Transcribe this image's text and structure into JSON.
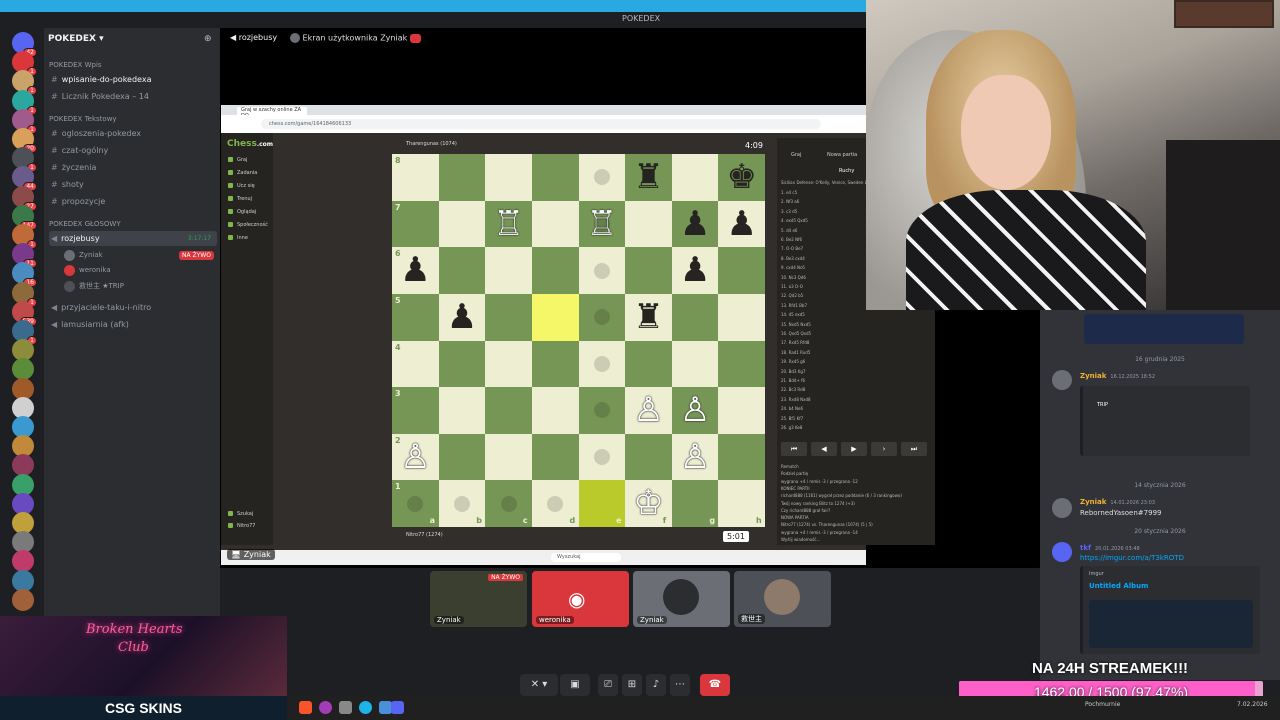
{
  "window_title": "POKEDEX",
  "server": {
    "name": "POKEDEX",
    "categories": {
      "wpis": "POKEDEX Wpis",
      "tekstowy": "POKEDEX Tekstowy",
      "glosowy": "POKEDEX GŁOSOWY"
    },
    "channels": {
      "wpisanie": "wpisanie-do-pokedexa",
      "licznik": "Licznik Pokedexa – 14",
      "ogloszenia": "ogloszenia-pokedex",
      "czat": "czat-ogólny",
      "zyczenia": "życzenia",
      "shoty": "shoty",
      "propozycje": "propozycje",
      "rozjebusy": "rozjebusy",
      "rozjebusy_time": "3:17:17",
      "przyjaciele": "przyjaciele-taku-i-nitro",
      "lamusiarnia": "lamusiarnia (afk)"
    },
    "voice_users": [
      "Zyniak",
      "weronika",
      "救世主 ★TRIP"
    ],
    "live_badge": "NA ŻYWO",
    "badges": [
      "42",
      "1",
      "1",
      "1",
      "1",
      "20",
      "1",
      "44",
      "27",
      "147",
      "1",
      "11",
      "16",
      "1",
      "539",
      "1"
    ]
  },
  "stream_header": {
    "channel": "rozjebusy",
    "screen_label": "Ekran użytkownika Zyniak"
  },
  "browser": {
    "tab": "Graj w szachy online ZA DO...",
    "url": "chess.com/game/164184606133"
  },
  "chess": {
    "logo_a": "Chess",
    "logo_b": ".com",
    "nav": [
      "Graj",
      "Zadania",
      "Ucz się",
      "Trenuj",
      "Oglądaj",
      "Społeczność",
      "Inne"
    ],
    "search": "Szukaj",
    "user_bottom": "Nitro77",
    "top_player": "Tharengunas (1074)",
    "bottom_player": "Nitro77 (1274)",
    "top_clock": "4:09",
    "bottom_clock": "5:01",
    "files": [
      "a",
      "b",
      "c",
      "d",
      "e",
      "f",
      "g",
      "h"
    ],
    "ranks": [
      "8",
      "7",
      "6",
      "5",
      "4",
      "3",
      "2",
      "1"
    ],
    "tabs": [
      "Graj",
      "Nowa partia"
    ],
    "moves_label": "Ruchy",
    "opening": "Sicilian Defense: O'Kelly, Venice, Sweden Line",
    "move_list": [
      "e4 c5",
      "Nf3 a6",
      "c3 d5",
      "exd5 Qxd5",
      "d4 e6",
      "Be2 Nf6",
      "O-O Be7",
      "Be3 cxd4",
      "cxd4 Nc6",
      "Nc3 Qd6",
      "a3 O-O",
      "Qd2 b5",
      "Rfd1 Bb7",
      "d5 exd5",
      "Nxd5 Nxd5",
      "Qxd5 Qxd5",
      "Rxd5 Rfd8",
      "Rad1 Rxd5",
      "Rxd5 g6",
      "Bd3 Kg7",
      "Bd4+ f6",
      "Bc3 Rd8",
      "Rxd8 Nxd8",
      "b4 Ne6",
      "Bf1 Kf7",
      "g3 Ke8"
    ],
    "chat_lines": [
      "Rematch",
      "Podziel partię",
      "wygrana +4 / remis -3 / przegrana -12",
      "KONIEC PARTII",
      "richard888 (1161) wygrał przez poddanie (6 / 3 rankingowo)",
      "Twój nowy ranking Blitz to 1274 (+3)",
      "Czy richard888 grał fair?",
      "NOWA PARTIA",
      "Nitro77 (1274) vs. Tharengunas (1074) (5 | 5)",
      "wygrana +4 / remis -3 / przegrana -14",
      "Wyślij wiadomość..."
    ],
    "taskbar_search": "Wyszukaj"
  },
  "tiles": [
    {
      "label": "Zyniak",
      "badge": "NA ŻYWO",
      "color": "#3a3f30"
    },
    {
      "label": "weronika",
      "color": "#da373c"
    },
    {
      "label": "Zyniak",
      "color": "#6b6f75"
    },
    {
      "label": "救世主",
      "color": "#4d5057"
    }
  ],
  "right_chat": {
    "date1": "16 grudnia 2025",
    "msg1_user": "Zyniak",
    "msg1_time": "16.12.2025 18:52",
    "embed1_title": "TRIP",
    "date2": "14 stycznia 2026",
    "msg2_user": "Zyniak",
    "msg2_time": "14.01.2026 23:03",
    "msg2_text": "RebornedYasoen#7999",
    "date3": "20 stycznia 2026",
    "msg3_user": "tkf",
    "msg3_time": "20.01.2026 03:48",
    "msg3_link": "https://imgur.com/a/T3kROTD",
    "embed_site": "Imgur",
    "embed_title": "Untitled Album"
  },
  "webcam_overlay": {
    "sign1": "Broken Hearts",
    "sign2": "Club",
    "sponsor": "CSG SKINS"
  },
  "stream_goal": {
    "headline": "NA 24H STREAMEK!!!",
    "text": "1462.00 / 1500 (97.47%)",
    "progress": 0.9747
  },
  "win_taskbar": {
    "weather": "Pochmurnie",
    "date": "7.02.2026"
  },
  "colors": {
    "accent": "#5865f2",
    "live": "#da373c",
    "online": "#23a55a",
    "goal_fill": "#ff5fc8"
  }
}
